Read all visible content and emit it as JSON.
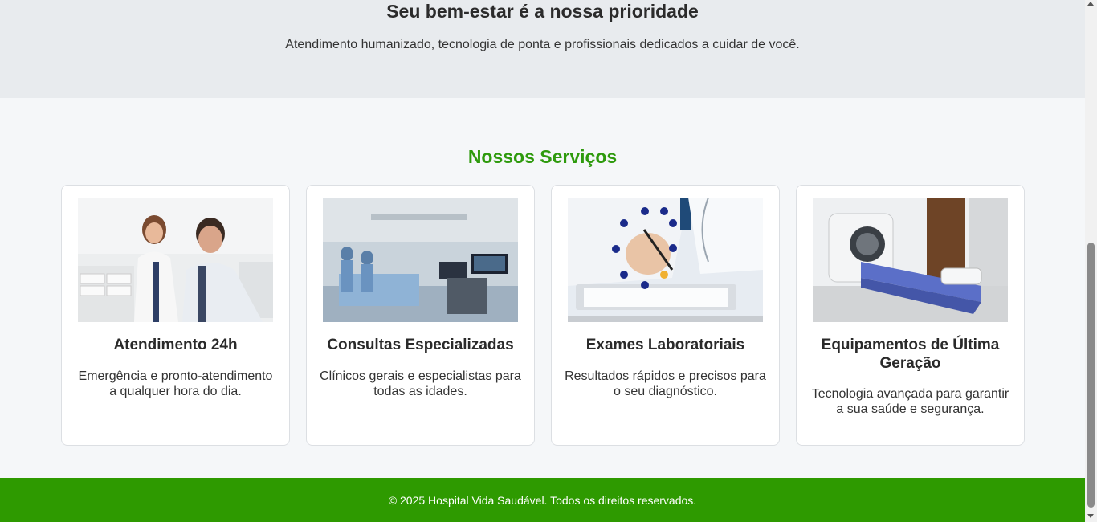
{
  "hero": {
    "title": "Seu bem-estar é a nossa prioridade",
    "subtitle": "Atendimento humanizado, tecnologia de ponta e profissionais dedicados a cuidar de você."
  },
  "services": {
    "title": "Nossos Serviços",
    "cards": [
      {
        "title": "Atendimento 24h",
        "description": "Emergência e pronto-atendimento a qualquer hora do dia.",
        "image_icon": "doctor-patient-photo"
      },
      {
        "title": "Consultas Especializadas",
        "description": "Clínicos gerais e especialistas para todas as idades.",
        "image_icon": "operating-room-photo"
      },
      {
        "title": "Exames Laboratoriais",
        "description": "Resultados rápidos e precisos para o seu diagnóstico.",
        "image_icon": "doctor-tablet-photo"
      },
      {
        "title": "Equipamentos de Última Geração",
        "description": "Tecnologia avançada para garantir a sua saúde e segurança.",
        "image_icon": "ct-scanner-photo"
      }
    ]
  },
  "footer": {
    "text": "© 2025 Hospital Vida Saudável. Todos os direitos reservados."
  },
  "colors": {
    "accent_green": "#2e9a0d",
    "footer_green": "#2e9a00",
    "hero_bg": "#e8ebee"
  }
}
